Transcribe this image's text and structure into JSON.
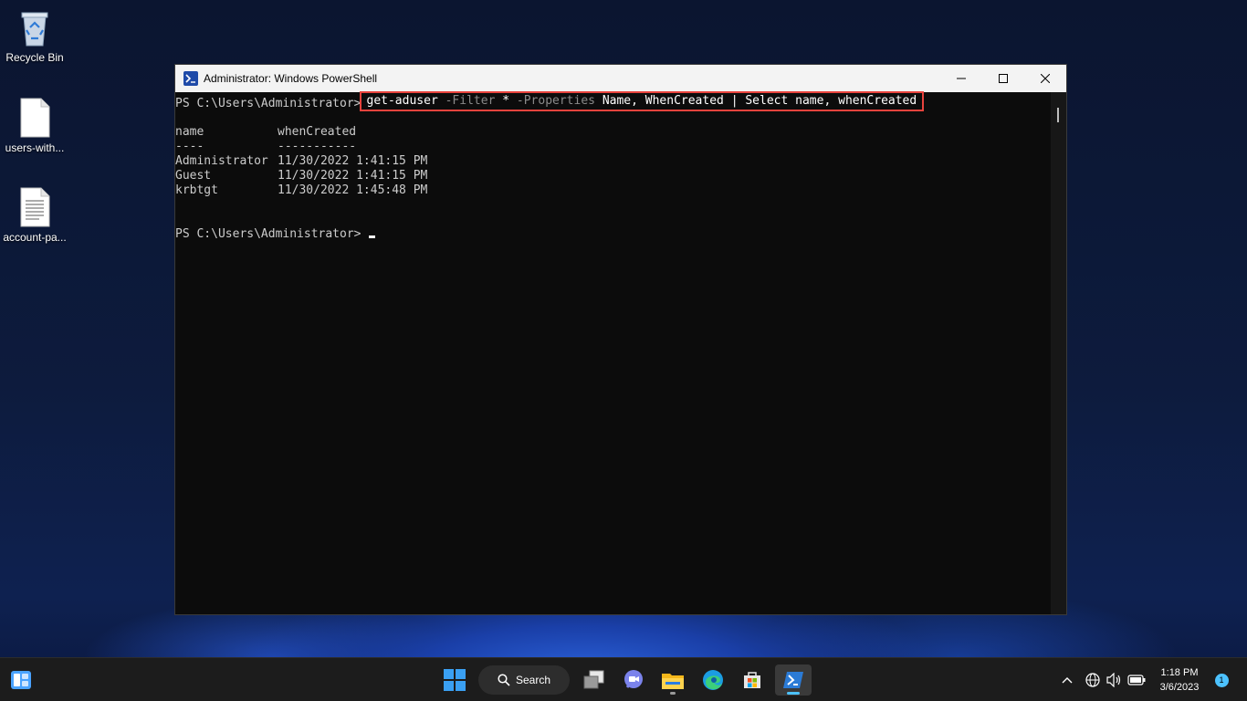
{
  "desktop": {
    "icons": [
      {
        "label": "Recycle Bin",
        "icon": "recycle-bin-icon"
      },
      {
        "label": "users-with...",
        "icon": "blank-file-icon"
      },
      {
        "label": "account-pa...",
        "icon": "text-file-icon"
      }
    ]
  },
  "window": {
    "title": "Administrator: Windows PowerShell",
    "controls": {
      "minimize": "minimize-icon",
      "maximize": "maximize-icon",
      "close": "close-icon"
    }
  },
  "console": {
    "prompt": "PS C:\\Users\\Administrator>",
    "command": {
      "cmdlet": "get-aduser",
      "param1": "-Filter",
      "star": "*",
      "param2": "-Properties",
      "args": "Name, WhenCreated",
      "pipe": "|",
      "select": "Select",
      "select_args": "name, whenCreated"
    },
    "headers": [
      "name",
      "whenCreated"
    ],
    "separators": [
      "----",
      "-----------"
    ],
    "rows": [
      {
        "name": "Administrator",
        "whenCreated": "11/30/2022 1:41:15 PM"
      },
      {
        "name": "Guest",
        "whenCreated": "11/30/2022 1:41:15 PM"
      },
      {
        "name": "krbtgt",
        "whenCreated": "11/30/2022 1:45:48 PM"
      }
    ],
    "highlight_color": "#e8433d"
  },
  "taskbar": {
    "search_label": "Search",
    "apps": [
      "widgets-icon",
      "start-icon",
      "search-icon",
      "task-view-icon",
      "teams-chat-icon",
      "file-explorer-icon",
      "edge-icon",
      "store-icon",
      "powershell-icon"
    ],
    "tray": {
      "time": "1:18 PM",
      "date": "3/6/2023",
      "notifications": "1"
    }
  }
}
